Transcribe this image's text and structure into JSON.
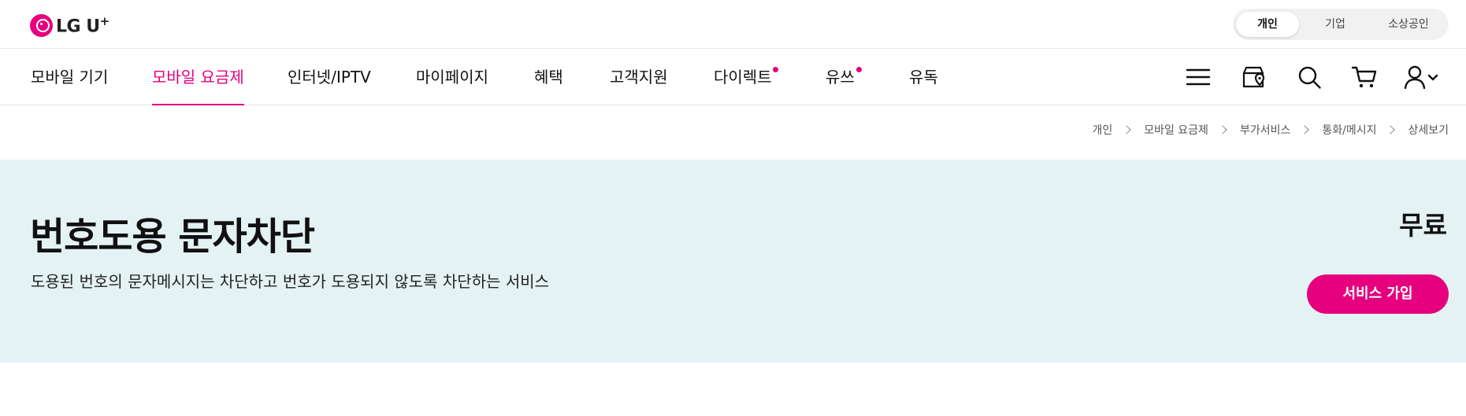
{
  "header": {
    "logo_text": "LG U",
    "logo_plus": "+",
    "segments": [
      "개인",
      "기업",
      "소상공인"
    ],
    "active_segment": "개인"
  },
  "nav": {
    "items": [
      {
        "label": "모바일 기기",
        "active": false,
        "dot": false
      },
      {
        "label": "모바일 요금제",
        "active": true,
        "dot": false
      },
      {
        "label": "인터넷/IPTV",
        "active": false,
        "dot": false
      },
      {
        "label": "마이페이지",
        "active": false,
        "dot": false
      },
      {
        "label": "혜택",
        "active": false,
        "dot": false
      },
      {
        "label": "고객지원",
        "active": false,
        "dot": false
      },
      {
        "label": "다이렉트",
        "active": false,
        "dot": true
      },
      {
        "label": "유쓰",
        "active": false,
        "dot": true
      },
      {
        "label": "유독",
        "active": false,
        "dot": false
      }
    ],
    "icons": [
      "menu-icon",
      "store-location-icon",
      "search-icon",
      "cart-icon",
      "user-icon"
    ]
  },
  "breadcrumb": [
    "개인",
    "모바일 요금제",
    "부가서비스",
    "통화/메시지",
    "상세보기"
  ],
  "hero": {
    "title": "번호도용 문자차단",
    "description": "도용된 번호의 문자메시지는 차단하고 번호가 도용되지 않도록 차단하는 서비스",
    "price": "무료",
    "cta_label": "서비스 가입"
  },
  "colors": {
    "brand": "#e6007e",
    "hero_bg": "#e4f2f3"
  }
}
